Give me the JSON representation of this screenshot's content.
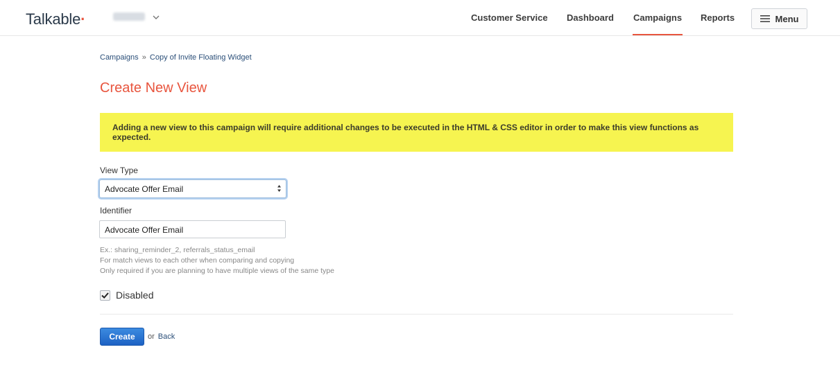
{
  "header": {
    "logo_text": "Talkable",
    "nav": [
      {
        "label": "Customer Service"
      },
      {
        "label": "Dashboard"
      },
      {
        "label": "Campaigns",
        "active": true
      },
      {
        "label": "Reports"
      }
    ],
    "menu_label": "Menu",
    "icons": {
      "switcher": "chevron-down-icon",
      "menu": "hamburger-icon"
    }
  },
  "breadcrumb": {
    "root": "Campaigns",
    "separator": "»",
    "current": "Copy of Invite Floating Widget"
  },
  "page_title": "Create New View",
  "alert_text": "Adding a new view to this campaign will require additional changes to be executed in the HTML & CSS editor in order to make this view functions as expected.",
  "form": {
    "view_type_label": "View Type",
    "view_type_value": "Advocate Offer Email",
    "identifier_label": "Identifier",
    "identifier_value": "Advocate Offer Email",
    "help_lines": [
      "Ex.: sharing_reminder_2, referrals_status_email",
      "For match views to each other when comparing and copying",
      "Only required if you are planning to have multiple views of the same type"
    ],
    "disabled_label": "Disabled",
    "disabled_checked": true
  },
  "actions": {
    "create_label": "Create",
    "or_text": "or",
    "back_label": "Back"
  },
  "colors": {
    "accent": "#e8553e",
    "alert_bg": "#f6f450",
    "link": "#2a4e78",
    "primary_button": "#1d62c4"
  }
}
